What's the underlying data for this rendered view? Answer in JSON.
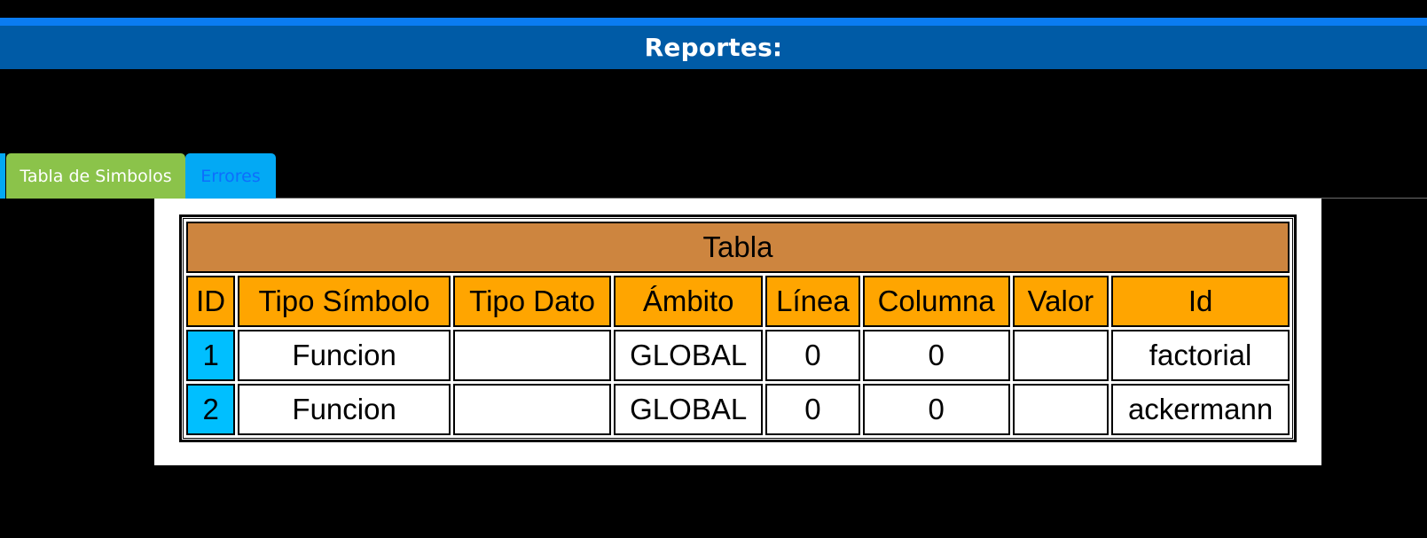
{
  "header": {
    "title": "Reportes:"
  },
  "tabs": [
    {
      "label": "Tabla de Simbolos",
      "active": true
    },
    {
      "label": "Errores",
      "active": false
    }
  ],
  "table": {
    "caption": "Tabla",
    "columns": [
      "ID",
      "Tipo Símbolo",
      "Tipo Dato",
      "Ámbito",
      "Línea",
      "Columna",
      "Valor",
      "Id"
    ],
    "rows": [
      [
        "1",
        "Funcion",
        "",
        "GLOBAL",
        "0",
        "0",
        "",
        "factorial"
      ],
      [
        "2",
        "Funcion",
        "",
        "GLOBAL",
        "0",
        "0",
        "",
        "ackermann"
      ]
    ]
  },
  "colors": {
    "header_bar": "#005ba6",
    "top_accent": "#0a7cf2",
    "tab_active": "#8bc34a",
    "tab_inactive": "#03a9f4",
    "caption_bg": "#cd853f",
    "column_head_bg": "#ffa500",
    "id_cell_bg": "#00bfff"
  }
}
